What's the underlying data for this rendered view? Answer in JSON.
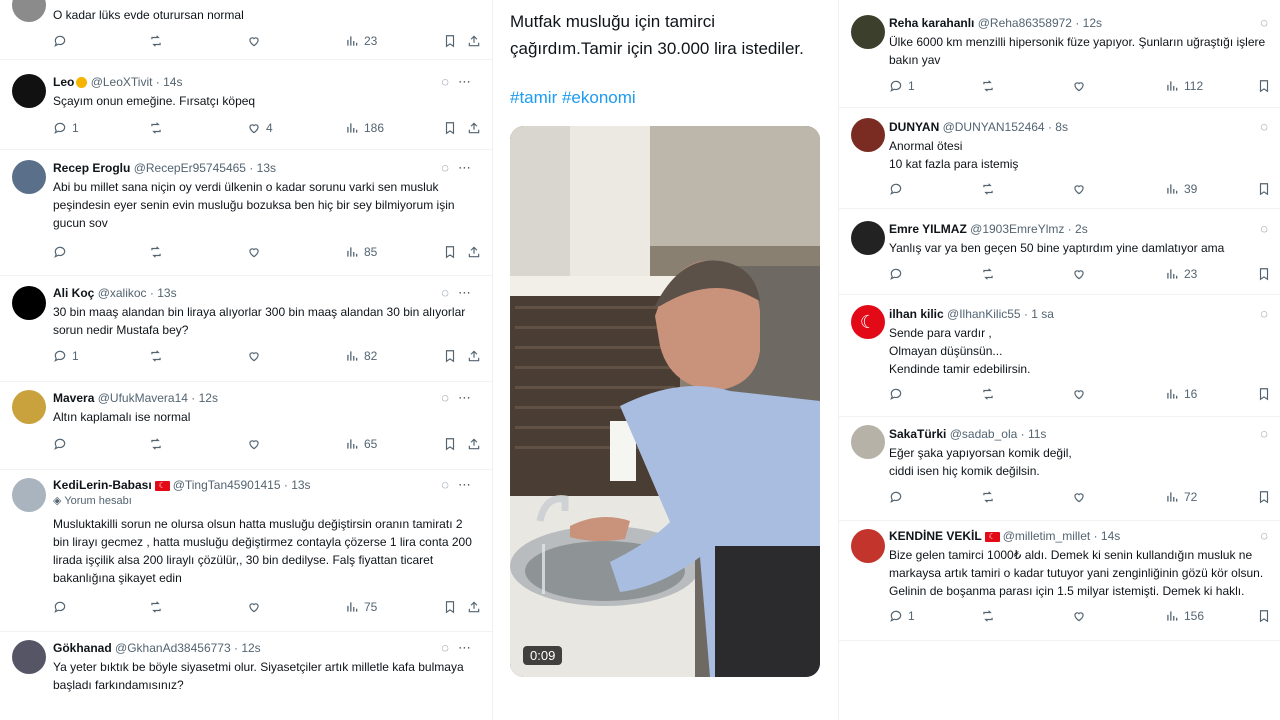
{
  "left": {
    "tweets": [
      {
        "name": "",
        "handle": "",
        "time": "",
        "text": "O kadar lüks evde oturursan normal",
        "stats": {
          "replies": "",
          "retweets": "",
          "likes": "",
          "views": "23"
        }
      },
      {
        "name": "Leo",
        "handle": "@LeoXTivit",
        "time": "· 14s",
        "text": "Sçayım onun emeğine. Fırsatçı köpeq",
        "stats": {
          "replies": "1",
          "retweets": "",
          "likes": "4",
          "views": "186"
        }
      },
      {
        "name": "Recep Eroglu",
        "handle": "@RecepEr95745465",
        "time": "· 13s",
        "text": "Abi bu millet sana niçin oy verdi ülkenin o kadar sorunu varki sen musluk peşindesin eyer senin evin musluğu bozuksa ben hiç bir sey bilmiyorum işin gucun sov",
        "stats": {
          "replies": "",
          "retweets": "",
          "likes": "",
          "views": "85"
        }
      },
      {
        "name": "Ali Koç",
        "handle": "@xalikoc",
        "time": "· 13s",
        "text": "30 bin maaş alandan bin liraya alıyorlar 300 bin maaş alandan 30 bin alıyorlar sorun nedir Mustafa bey?",
        "stats": {
          "replies": "1",
          "retweets": "",
          "likes": "",
          "views": "82"
        }
      },
      {
        "name": "Mavera",
        "handle": "@UfukMavera14",
        "time": "· 12s",
        "text": "Altın kaplamalı ise normal",
        "stats": {
          "replies": "",
          "retweets": "",
          "likes": "",
          "views": "65"
        }
      },
      {
        "name": "KediLerin-Babası",
        "handle": "@TingTan45901415",
        "time": "· 13s",
        "sub": "Yorum hesabı",
        "text": "Musluktakilli sorun ne olursa olsun  hatta musluğu değiştirsin oranın tamiratı 2 bin lirayı gecmez , hatta musluğu değiştirmez contayla çözerse 1 lira conta 200 lirada işçilik alsa 200 liraylı çözülür,, 30 bin dedilyse. Falş fiyattan ticaret bakanlığına şikayet edin",
        "stats": {
          "replies": "",
          "retweets": "",
          "likes": "",
          "views": "75"
        }
      },
      {
        "name": "Gökhanad",
        "handle": "@GkhanAd38456773",
        "time": "· 12s",
        "text": "Ya yeter bıktık be böyle siyasetmi olur. Siyasetçiler artık milletle kafa bulmaya başladı farkındamısınız?"
      }
    ]
  },
  "middle": {
    "text": "Mutfak musluğu için tamirci çağırdım.Tamir için 30.000 lira istediler.",
    "hashtags": "#tamir #ekonomi",
    "video_duration": "0:09"
  },
  "right": {
    "tweets": [
      {
        "name": "Reha karahanlı",
        "handle": "@Reha86358972",
        "time": "· 12s",
        "text": "Ülke 6000 km menzilli hipersonik füze yapıyor. Şunların uğraştığı işlere bakın yav",
        "stats": {
          "replies": "1",
          "retweets": "",
          "likes": "",
          "views": "112"
        }
      },
      {
        "name": "DUNYAN",
        "handle": "@DUNYAN152464",
        "time": "· 8s",
        "text": "Anormal ötesi\n10 kat fazla para istemiş",
        "stats": {
          "replies": "",
          "retweets": "",
          "likes": "",
          "views": "39"
        }
      },
      {
        "name": "Emre YILMAZ",
        "handle": "@1903EmreYlmz",
        "time": "· 2s",
        "text": "Yanlış var ya ben geçen 50 bine yaptırdım yine damlatıyor ama",
        "stats": {
          "replies": "",
          "retweets": "",
          "likes": "",
          "views": "23"
        }
      },
      {
        "name": "ilhan kilic",
        "handle": "@IlhanKilic55",
        "time": "· 1 sa",
        "text": "Sende para vardır ,\nOlmayan düşünsün...\nKendinde tamir edebilirsin.",
        "stats": {
          "replies": "",
          "retweets": "",
          "likes": "",
          "views": "16"
        }
      },
      {
        "name": "SakaTürki",
        "handle": "@sadab_ola",
        "time": "· 11s",
        "text": "Eğer şaka yapıyorsan komik değil,\nciddi isen hiç komik değilsin.",
        "stats": {
          "replies": "",
          "retweets": "",
          "likes": "",
          "views": "72"
        }
      },
      {
        "name": "KENDİNE VEKİL",
        "handle": "@milletim_millet",
        "time": "· 14s",
        "text": "Bize gelen tamirci 1000₺ aldı. Demek ki senin kullandığın musluk ne markaysa artık tamiri o kadar tutuyor yani zenginliğinin gözü kör olsun. Gelinin de boşanma parası için 1.5 milyar istemişti. Demek ki haklı.",
        "stats": {
          "replies": "1",
          "retweets": "",
          "likes": "",
          "views": "156"
        }
      }
    ]
  },
  "colors": {
    "text": "#0f1419",
    "muted": "#536471",
    "link": "#1d9bf0",
    "border": "#eff3f4"
  },
  "icons": {
    "reply": "reply-icon",
    "retweet": "retweet-icon",
    "like": "heart-icon",
    "views": "views-icon",
    "bookmark": "bookmark-icon",
    "share": "share-icon",
    "grok": "grok-icon",
    "more": "more-icon"
  }
}
